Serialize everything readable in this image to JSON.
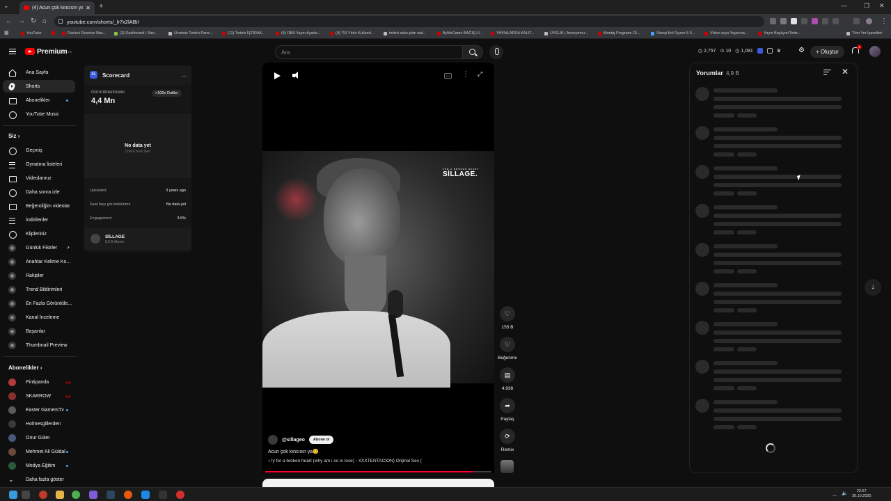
{
  "browser": {
    "tab_title": "(4) Acun çok kıncısın ya😊 - YouT",
    "url": "youtube.com/shorts/_lr7x2lABiI",
    "bookmarks": [
      "YouTube",
      "Davinci Resolve Nas...",
      "(3) Dashboard / Stre...",
      "Ücretsiz Twitch Pane...",
      "(11) Twitch İŞTIRAK...",
      "(4) OBS Yayın Ayarla...",
      "(4) *10 Yıldır Kulland...",
      "twitch seks plan wal...",
      "ByNoGame BAĞIŞ Lİ...",
      "YAYINLARDA KALIT...",
      "ÜYELİK | Anonymou...",
      "Montaj Programı Öl...",
      "Sineşi Kol Ryzen 5 5...",
      "Video veya Yayınına...",
      "Yayın Başlıyor/Twitc..."
    ],
    "all_bookmarks": "Tüm Yer İşaretleri"
  },
  "header": {
    "logo": "Premium",
    "logo_sup": "TR",
    "search_placeholder": "Ara",
    "stats": [
      "2,757",
      "10",
      "1,091"
    ],
    "create_label": "+ Oluştur",
    "notif_count": "4"
  },
  "sidebar": {
    "main": [
      {
        "label": "Ana Sayfa",
        "icon": "home-icon"
      },
      {
        "label": "Shorts",
        "icon": "shorts-icon"
      },
      {
        "label": "Abonelikler",
        "icon": "subscriptions-icon"
      },
      {
        "label": "YouTube Music",
        "icon": "music-icon"
      }
    ],
    "you_header": "Siz",
    "you": [
      {
        "label": "Geçmiş",
        "icon": "history-icon"
      },
      {
        "label": "Oynatma listeleri",
        "icon": "playlist-icon"
      },
      {
        "label": "Videolarınız",
        "icon": "videos-icon"
      },
      {
        "label": "Daha sonra izle",
        "icon": "watch-later-icon"
      },
      {
        "label": "Beğendiğim videolar",
        "icon": "like-icon"
      },
      {
        "label": "İndirilenler",
        "icon": "download-icon"
      },
      {
        "label": "Klipleriniz",
        "icon": "clips-icon"
      },
      {
        "label": "Günlük Fikirler",
        "icon": "extension-icon"
      },
      {
        "label": "Anahtar Kelime Ko...",
        "icon": "extension-icon"
      },
      {
        "label": "Rakipler",
        "icon": "extension-icon"
      },
      {
        "label": "Trend Bildirimleri",
        "icon": "extension-icon"
      },
      {
        "label": "En Fazla Görüntüle...",
        "icon": "extension-icon"
      },
      {
        "label": "Kanal İnceleme",
        "icon": "extension-icon"
      },
      {
        "label": "Başarılar",
        "icon": "extension-icon"
      },
      {
        "label": "Thumbnail Preview",
        "icon": "extension-icon"
      }
    ],
    "subs_header": "Abonelikler",
    "subs": [
      {
        "label": "Pintipanda",
        "color": "#b33a3a"
      },
      {
        "label": "SKARROW",
        "color": "#8a2f2f"
      },
      {
        "label": "Easter GamersTv",
        "color": "#5a5a5a"
      },
      {
        "label": "Holmesgillerden",
        "color": "#3a3a3a"
      },
      {
        "label": "Onur Güler",
        "color": "#4a5b7a"
      },
      {
        "label": "Mehmet Ali Güldal",
        "color": "#6a4a3a"
      },
      {
        "label": "Medya Eğitim",
        "color": "#2a5a3a"
      }
    ],
    "show_more": "Daha fazla göster"
  },
  "scorecard": {
    "title": "Scorecard",
    "logo": "XL",
    "views_label": "Görüntülenmeler",
    "views": "4,4 Mn",
    "outlier": ">100x Outlier",
    "no_data": "No data yet",
    "no_data_sub": "Check back later",
    "rows": [
      {
        "label": "Uploaded",
        "value": "3 years ago"
      },
      {
        "label": "Saat başı görüntülenme",
        "value": "No data yet"
      },
      {
        "label": "Engagement",
        "value": "3.5%"
      }
    ],
    "channel_name": "SİLLAGE",
    "channel_subs": "8,9 B Abone"
  },
  "player": {
    "watermark": "SİLLAGE.",
    "watermark_small": "FOR A BROKEN HEART",
    "handle": "@sillageo",
    "subscribe": "Abone ol",
    "caption": "Acun çok kıncısın ya😊",
    "music": "♪ ly for a broken heart (why am i so in love) - XXXTENTACION)   Orijinal Ses (",
    "progress": 0.92
  },
  "actions": [
    {
      "label": "155 B",
      "icon": "like-icon",
      "glyph": "👍"
    },
    {
      "label": "Beğenme",
      "icon": "dislike-icon",
      "glyph": "👎"
    },
    {
      "label": "4.938",
      "icon": "comment-icon",
      "glyph": "▤"
    },
    {
      "label": "Paylaş",
      "icon": "share-icon",
      "glyph": "➦"
    },
    {
      "label": "Remix",
      "icon": "remix-icon",
      "glyph": "⟳"
    }
  ],
  "comments": {
    "title": "Yorumlar",
    "count": "4,9 B"
  },
  "taskbar": {
    "time": "22:57",
    "date": "30.10.2025"
  }
}
